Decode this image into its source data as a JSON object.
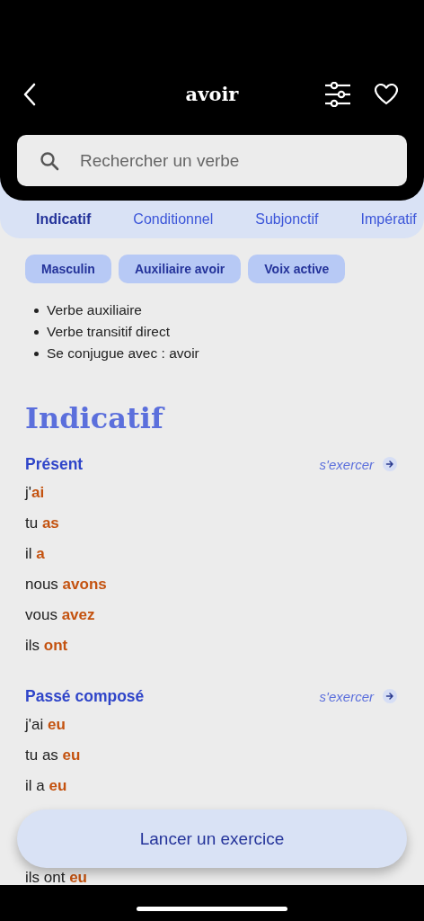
{
  "header": {
    "title": "avoir"
  },
  "search": {
    "placeholder": "Rechercher un verbe"
  },
  "tabs": [
    {
      "label": "Indicatif",
      "selected": true
    },
    {
      "label": "Conditionnel",
      "selected": false
    },
    {
      "label": "Subjonctif",
      "selected": false
    },
    {
      "label": "Impératif",
      "selected": false
    }
  ],
  "tags": [
    "Masculin",
    "Auxiliaire avoir",
    "Voix active"
  ],
  "notes": [
    "Verbe auxiliaire",
    "Verbe transitif direct",
    "Se conjugue avec : avoir"
  ],
  "mood": {
    "title": "Indicatif",
    "tenses": [
      {
        "name": "Présent",
        "practice": "s'exercer",
        "forms": [
          "j'**ai**",
          "tu **as**",
          "il **a**",
          "nous **avons**",
          "vous **avez**",
          "ils **ont**"
        ]
      },
      {
        "name": "Passé composé",
        "practice": "s'exercer",
        "forms": [
          "j'ai **eu**",
          "tu as **eu**",
          "il a **eu**",
          "ils ont **eu**"
        ]
      }
    ]
  },
  "exercise_button": "Lancer un exercice"
}
